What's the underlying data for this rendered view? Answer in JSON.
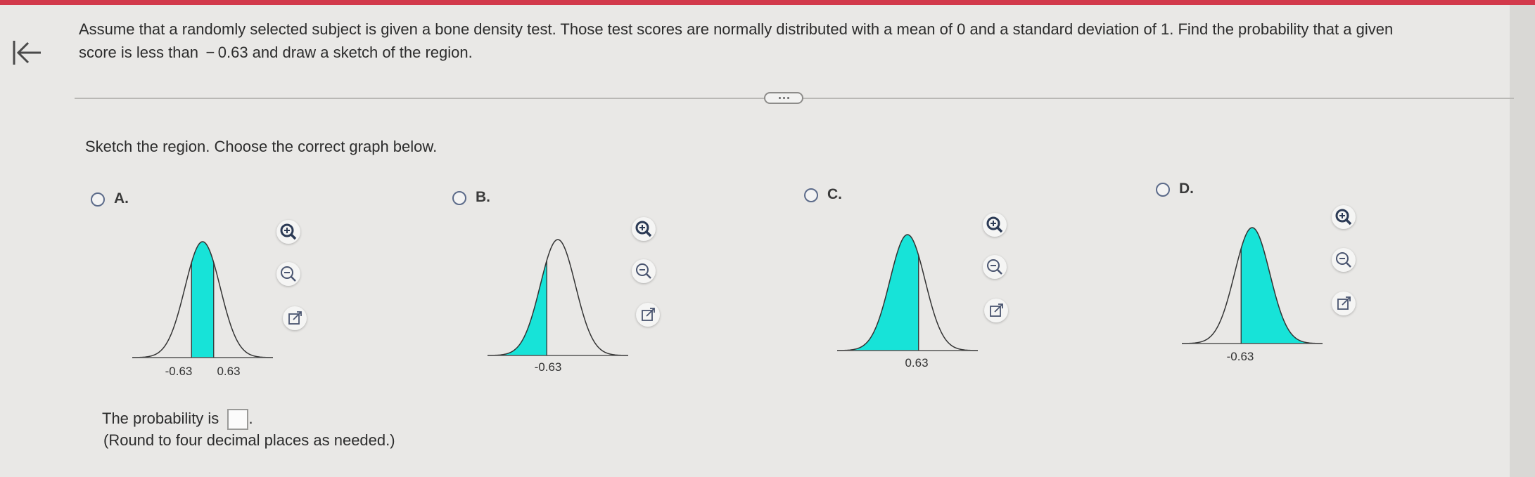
{
  "question": {
    "line1": "Assume that a randomly selected subject is given a bone density test. Those test scores are normally distributed with a mean of 0 and a standard deviation of 1. Find the probability that a given",
    "line2": "score is less than  − 0.63 and draw a sketch of the region."
  },
  "instruction": "Sketch the region. Choose the correct graph below.",
  "options": [
    {
      "letter": "A.",
      "shaded": "between",
      "labels": [
        "-0.63",
        "0.63"
      ]
    },
    {
      "letter": "B.",
      "shaded": "left of",
      "labels": [
        "-0.63"
      ]
    },
    {
      "letter": "C.",
      "shaded": "left of",
      "labels": [
        "0.63"
      ]
    },
    {
      "letter": "D.",
      "shaded": "right of",
      "labels": [
        "-0.63"
      ]
    }
  ],
  "tools": [
    "zoom-in-icon",
    "zoom-out-icon",
    "open-external-icon"
  ],
  "answer": {
    "prefix": "The probability is",
    "value": "",
    "suffix": ".",
    "note": "(Round to four decimal places as needed.)"
  },
  "colors": {
    "accent_bar": "#d2394b",
    "shade": "#17e3d8",
    "curve": "#333333"
  }
}
